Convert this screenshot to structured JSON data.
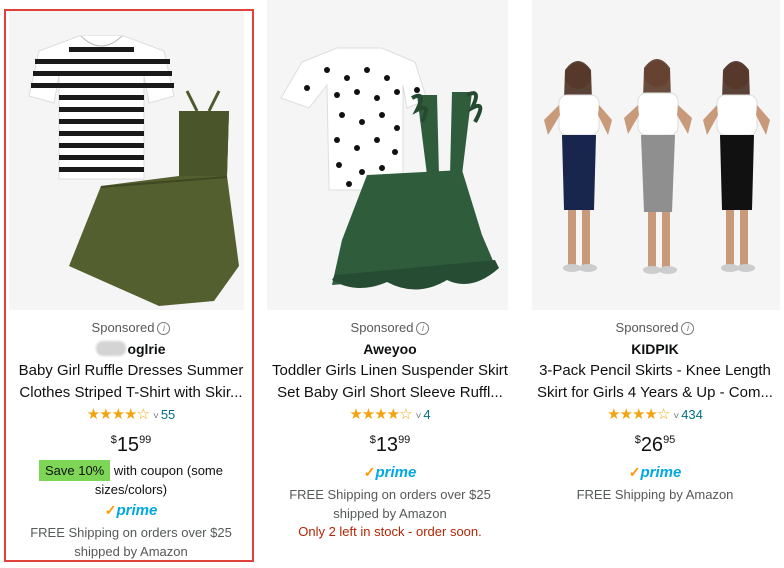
{
  "accent_colors": {
    "stars": "#f2a30f",
    "coupon_badge": "#7ed657",
    "link": "#007185",
    "prime": "#00a8e1",
    "low_stock": "#b12704",
    "highlight_border": "#e0413a"
  },
  "products": [
    {
      "sponsored": "Sponsored",
      "brand": "oglrie",
      "title_line1": "Baby Girl Ruffle Dresses Summer",
      "title_line2": "Clothes Striped T-Shirt with Skir...",
      "stars": "★★★★☆",
      "rating": 4.5,
      "chevron": "˅",
      "review_count": "55",
      "price_currency": "$",
      "price_whole": "15",
      "price_fraction": "99",
      "coupon_badge": "Save 10%",
      "coupon_text_line1": "with coupon (some",
      "coupon_text_line2": "sizes/colors)",
      "prime_label": "prime",
      "shipping_line1": "FREE Shipping on orders over $25",
      "shipping_line2": "shipped by Amazon"
    },
    {
      "sponsored": "Sponsored",
      "brand": "Aweyoo",
      "title_line1": "Toddler Girls Linen Suspender Skirt",
      "title_line2": "Set Baby Girl Short Sleeve Ruffl...",
      "stars": "★★★★☆",
      "rating": 4.5,
      "chevron": "˅",
      "review_count": "4",
      "price_currency": "$",
      "price_whole": "13",
      "price_fraction": "99",
      "prime_label": "prime",
      "shipping_line1": "FREE Shipping on orders over $25",
      "shipping_line2": "shipped by Amazon",
      "stock_text": "Only 2 left in stock - order soon."
    },
    {
      "sponsored": "Sponsored",
      "brand": "KIDPIK",
      "title_line1": "3-Pack Pencil Skirts - Knee Length",
      "title_line2": "Skirt for Girls 4 Years & Up - Com...",
      "stars": "★★★★☆",
      "rating": 4.5,
      "chevron": "˅",
      "review_count": "434",
      "price_currency": "$",
      "price_whole": "26",
      "price_fraction": "95",
      "prime_label": "prime",
      "shipping_line1": "FREE Shipping by Amazon"
    }
  ]
}
